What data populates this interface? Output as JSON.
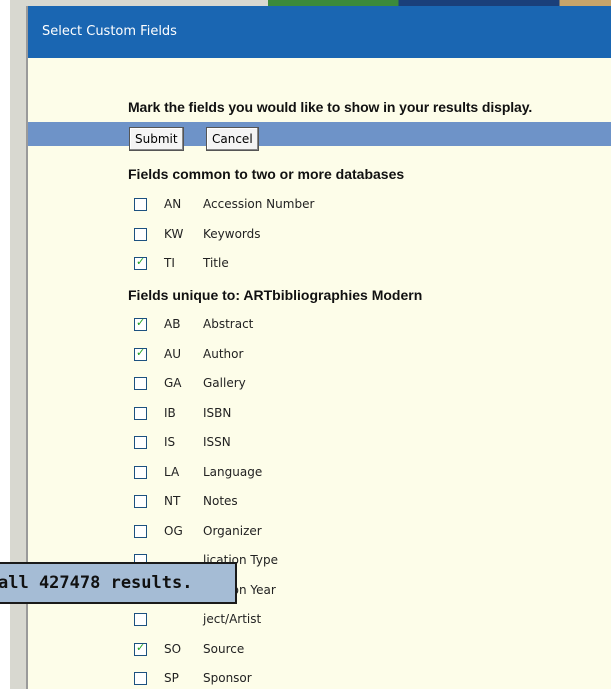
{
  "dialog": {
    "title": "Select Custom Fields",
    "instruction": "Mark the fields you would like to show in your results display.",
    "submit_label": "Submit",
    "cancel_label": "Cancel"
  },
  "common_section": {
    "heading": "Fields common to two or more databases",
    "fields": [
      {
        "code": "AN",
        "label": "Accession Number",
        "checked": false
      },
      {
        "code": "KW",
        "label": "Keywords",
        "checked": false
      },
      {
        "code": "TI",
        "label": "Title",
        "checked": true
      }
    ]
  },
  "unique_section": {
    "heading": "Fields unique to: ARTbibliographies Modern",
    "fields": [
      {
        "code": "AB",
        "label": "Abstract",
        "checked": true
      },
      {
        "code": "AU",
        "label": "Author",
        "checked": true
      },
      {
        "code": "GA",
        "label": "Gallery",
        "checked": false
      },
      {
        "code": "IB",
        "label": "ISBN",
        "checked": false
      },
      {
        "code": "IS",
        "label": "ISSN",
        "checked": false
      },
      {
        "code": "LA",
        "label": "Language",
        "checked": false
      },
      {
        "code": "NT",
        "label": "Notes",
        "checked": false
      },
      {
        "code": "OG",
        "label": "Organizer",
        "checked": false
      },
      {
        "code": "",
        "label": "lication Type",
        "checked": false
      },
      {
        "code": "",
        "label": "lication Year",
        "checked": false
      },
      {
        "code": "",
        "label": "ject/Artist",
        "checked": false
      },
      {
        "code": "SO",
        "label": "Source",
        "checked": true
      },
      {
        "code": "SP",
        "label": "Sponsor",
        "checked": false
      }
    ]
  },
  "toast": {
    "text": "all 427478 results."
  },
  "colors": {
    "titlebar": "#1a66b2",
    "dialog_bg": "#fdfde9",
    "toolbar_band": "#6e93c8",
    "checkmark": "#21a121",
    "toast_bg": "#a5bcd5"
  }
}
